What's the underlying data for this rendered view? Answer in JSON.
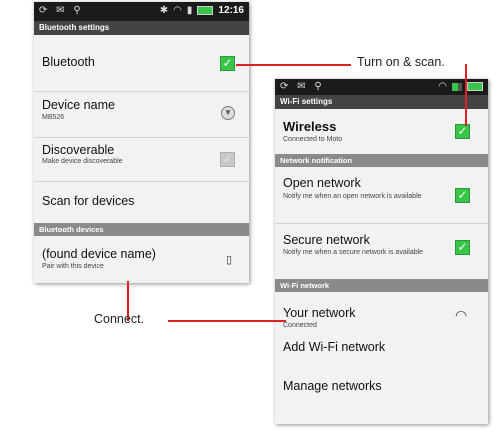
{
  "left": {
    "status": {
      "left_icons": "⟳ ✉ ⚲",
      "bt_icon": "✱",
      "wifi_icon": "◠",
      "signal_icon": "▮",
      "time": "12:16"
    },
    "title": "Bluetooth settings",
    "rows": [
      {
        "title": "Bluetooth",
        "subtitle": ""
      },
      {
        "title": "Device name",
        "subtitle": "MB526"
      },
      {
        "title": "Discoverable",
        "subtitle": "Make device discoverable"
      },
      {
        "title": "Scan for devices",
        "subtitle": ""
      }
    ],
    "section": "Bluetooth devices",
    "device": {
      "title": "(found device name)",
      "subtitle": "Pair with this device"
    },
    "check_mark": "✓",
    "dropdown_glyph": "▼",
    "phone_glyph": "▯"
  },
  "right": {
    "status": {
      "left_icons": "⟳ ✉ ⚲",
      "wifi_icon": "◠"
    },
    "title": "Wi-Fi settings",
    "wireless": {
      "title": "Wireless",
      "subtitle": "Connected to Moto"
    },
    "section_notification": "Network notification",
    "open": {
      "title": "Open network",
      "subtitle": "Notify me when an open network is available"
    },
    "secure": {
      "title": "Secure network",
      "subtitle": "Notify me when a secure network is available"
    },
    "section_network": "Wi-Fi network",
    "your_network": {
      "title": "Your network",
      "subtitle": "Connected"
    },
    "add": "Add Wi-Fi network",
    "manage": "Manage networks",
    "check_mark": "✓",
    "wifi_glyph": "◠"
  },
  "callouts": {
    "turn_on": "Turn on & scan.",
    "connect": "Connect."
  },
  "colors": {
    "check_green": "#39c44a",
    "callout_red": "#d22"
  }
}
